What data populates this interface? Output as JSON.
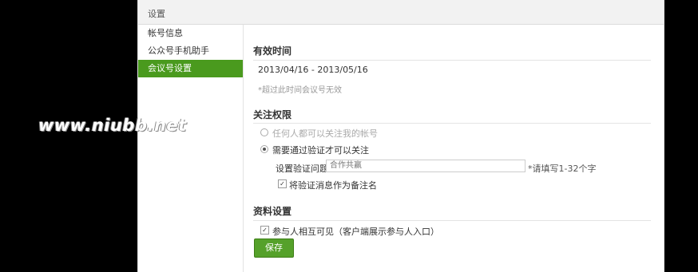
{
  "window": {
    "title": "设置"
  },
  "sidebar": {
    "items": [
      {
        "label": "帐号信息",
        "active": false
      },
      {
        "label": "公众号手机助手",
        "active": false
      },
      {
        "label": "会议号设置",
        "active": true
      }
    ]
  },
  "valid_period": {
    "title": "有效时间",
    "range": "2013/04/16 - 2013/05/16",
    "note": "*超过此时间会议号无效"
  },
  "follow_permission": {
    "title": "关注权限",
    "option_anyone": "任何人都可以关注我的帐号",
    "option_verify": "需要通过验证才可以关注",
    "selected": "option_verify",
    "question_label": "设置验证问题",
    "question_value": "合作共赢",
    "question_hint": "*请填写1-32个字",
    "use_as_remark_label": "将验证消息作为备注名",
    "use_as_remark_checked": true
  },
  "profile_settings": {
    "title": "资料设置",
    "mutual_visible_label": "参与人相互可见（客户端展示参与人入口）",
    "mutual_visible_checked": true
  },
  "actions": {
    "save_label": "保存"
  },
  "watermark": {
    "text": "www.niubb.net"
  },
  "colors": {
    "accent": "#4a9a1e",
    "background": "#000000"
  }
}
